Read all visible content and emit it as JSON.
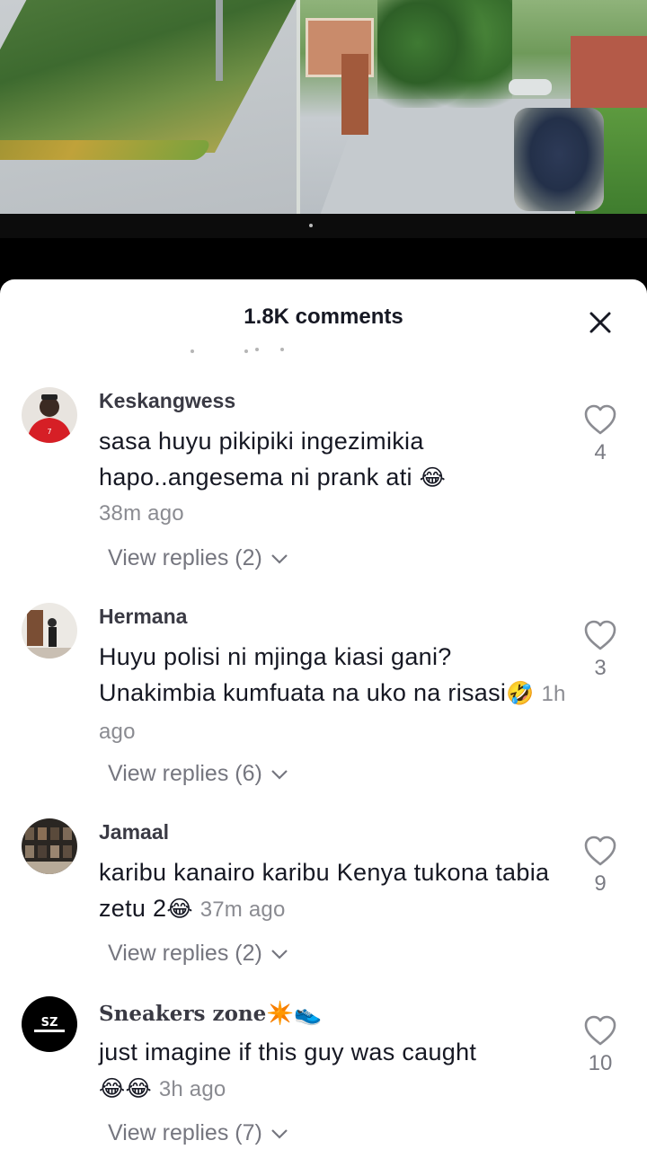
{
  "video": {
    "scene": "cctv-footage"
  },
  "sheet": {
    "title": "1.8K comments"
  },
  "comments": [
    {
      "username": "Keskangwess",
      "text": "sasa huyu pikipiki ingezimikia hapo..angesema ni prank ati",
      "emoji": "😂",
      "time": "38m ago",
      "replies": "View replies (2)",
      "likes": "4"
    },
    {
      "username": "Hermana",
      "text": "Huyu polisi ni mjinga kiasi gani? Unakimbia kumfuata na uko na risasi",
      "emoji": "🤣",
      "time": "1h ago",
      "replies": "View replies (6)",
      "likes": "3"
    },
    {
      "username": "Jamaal",
      "text": "karibu kanairo karibu Kenya tukona tabia zetu 2",
      "emoji": "😂",
      "time": "37m ago",
      "replies": "View replies (2)",
      "likes": "9"
    },
    {
      "username": "Sneakers zone",
      "username_emoji": "✴️👟",
      "text": "just imagine if this guy was caught",
      "emoji": "😂😂",
      "time": "3h ago",
      "replies": "View replies (7)",
      "likes": "10"
    }
  ],
  "colors": {
    "text_primary": "#161823",
    "text_secondary": "#8a8b91",
    "sheet_bg": "#ffffff"
  },
  "icons": {
    "close": "close-icon",
    "like": "heart-outline-icon",
    "expand": "chevron-down-icon"
  }
}
